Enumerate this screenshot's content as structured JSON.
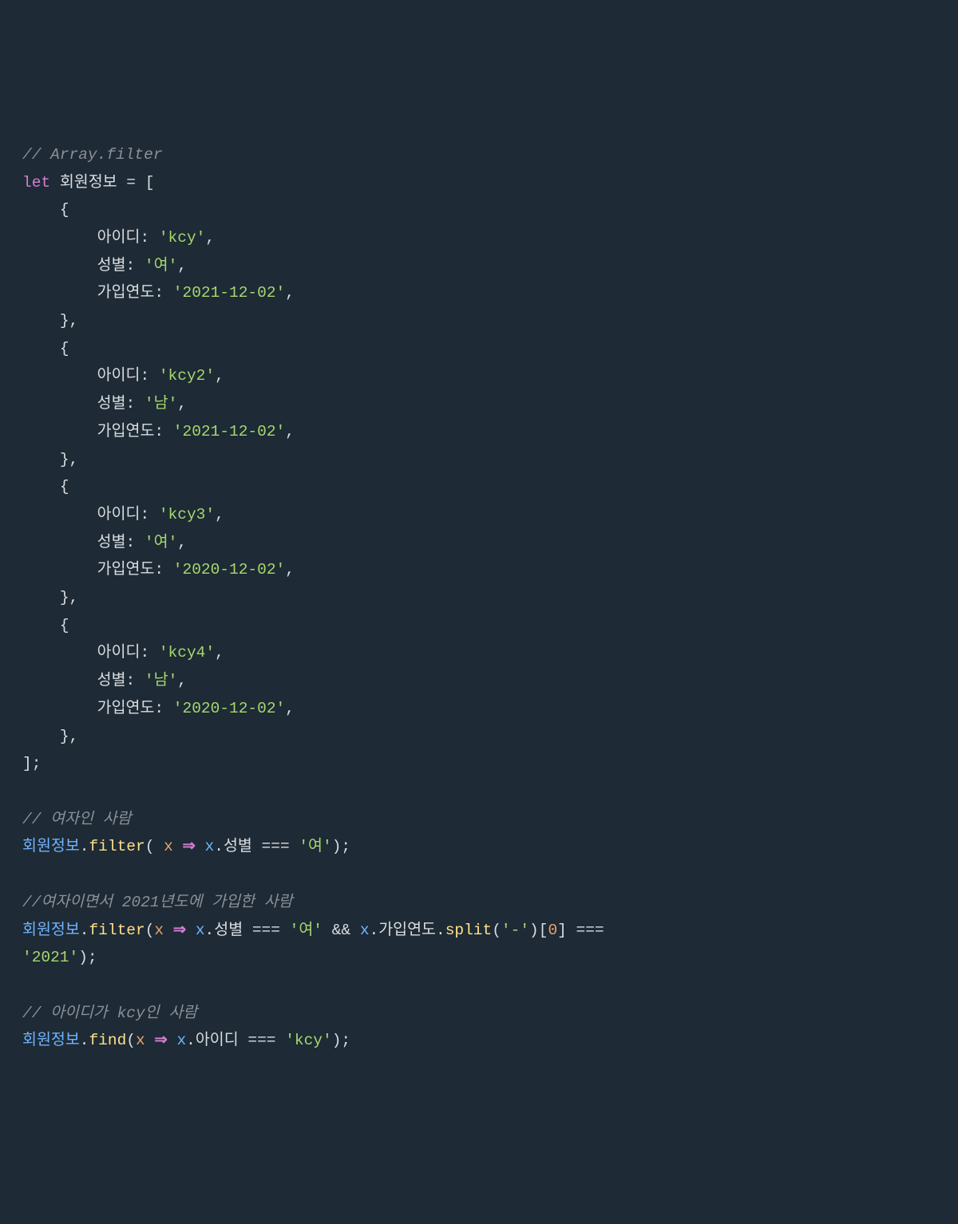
{
  "lines": {
    "c1": "// Array.filter",
    "kw_let": "let",
    "var_members": "회원정보",
    "eq": "=",
    "open_arr": "[",
    "open_brace": "{",
    "close_brace": "},",
    "close_brace_last": "},",
    "close_arr": "];",
    "prop_id": "아이디",
    "prop_gender": "성별",
    "prop_year": "가입연도",
    "colon": ":",
    "comma": ",",
    "m1_id": "'kcy'",
    "m1_gender": "'여'",
    "m1_year": "'2021-12-02'",
    "m2_id": "'kcy2'",
    "m2_gender": "'남'",
    "m2_year": "'2021-12-02'",
    "m3_id": "'kcy3'",
    "m3_gender": "'여'",
    "m3_year": "'2020-12-02'",
    "m4_id": "'kcy4'",
    "m4_gender": "'남'",
    "m4_year": "'2020-12-02'",
    "c2": "// 여자인 사람",
    "filter_fn": "filter",
    "find_fn": "find",
    "split_fn": "split",
    "param_x": "x",
    "arrow": "⇒",
    "dot": ".",
    "eqeqeq": "===",
    "and": "&&",
    "str_female": "'여'",
    "str_dash": "'-'",
    "idx0": "0",
    "str_2021": "'2021'",
    "str_kcy": "'kcy'",
    "semi": ";",
    "paren_o": "(",
    "paren_c": ")",
    "bracket_o": "[",
    "bracket_c": "]",
    "c3": "//여자이면서 2021년도에 가입한 사람",
    "c4": "// 아이디가 kcy인 사람"
  }
}
